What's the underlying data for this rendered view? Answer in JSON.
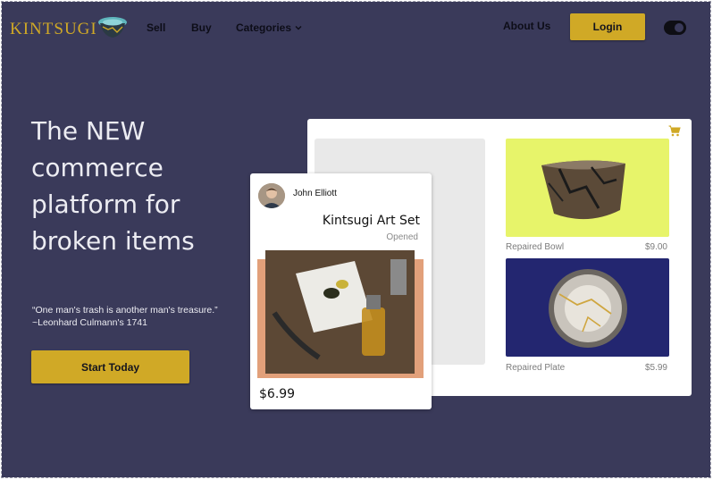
{
  "brand": {
    "name": "KINTSUGI",
    "logo_icon": "kintsugi-bowl-icon",
    "accent": "#d0a926",
    "background": "#3a3a5a"
  },
  "nav": {
    "links": [
      {
        "label": "Sell"
      },
      {
        "label": "Buy"
      },
      {
        "label": "Categories"
      }
    ],
    "about_label": "About Us",
    "login_label": "Login",
    "theme_toggle": {
      "icon": "dark-mode-toggle",
      "on": true
    }
  },
  "hero": {
    "headline": "The NEW commerce platform for broken items",
    "quote": "“One man's trash is another man's treasure.”",
    "attribution": "~Leonhard Culmann's 1741",
    "cta_label": "Start Today"
  },
  "listing_panel": {
    "cart_icon": "cart-icon",
    "items": [
      {
        "name": "Repaired Bowl",
        "price": "$9.00",
        "image": "repaired-bowl-image",
        "bg": "#e7f46a"
      },
      {
        "name": "Repaired Plate",
        "price": "$5.99",
        "image": "repaired-plate-image",
        "bg": "#232670"
      }
    ]
  },
  "featured_card": {
    "seller": "John Elliott",
    "title": "Kintsugi Art Set",
    "status": "Opened",
    "price": "$6.99",
    "image": "art-set-image"
  }
}
